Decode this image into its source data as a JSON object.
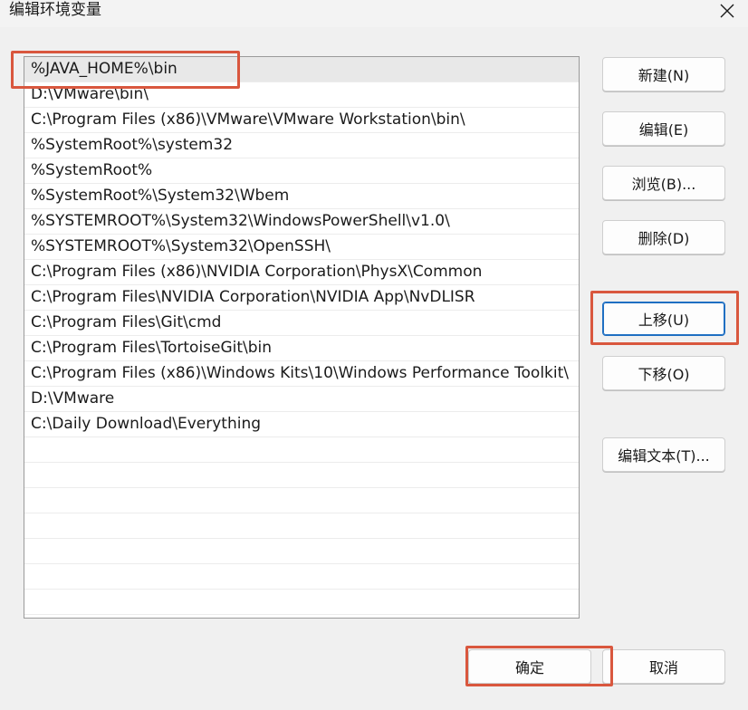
{
  "dialog": {
    "title": "编辑环境变量"
  },
  "paths": [
    "%JAVA_HOME%\\bin",
    "D:\\VMware\\bin\\",
    "C:\\Program Files (x86)\\VMware\\VMware Workstation\\bin\\",
    "%SystemRoot%\\system32",
    "%SystemRoot%",
    "%SystemRoot%\\System32\\Wbem",
    "%SYSTEMROOT%\\System32\\WindowsPowerShell\\v1.0\\",
    "%SYSTEMROOT%\\System32\\OpenSSH\\",
    "C:\\Program Files (x86)\\NVIDIA Corporation\\PhysX\\Common",
    "C:\\Program Files\\NVIDIA Corporation\\NVIDIA App\\NvDLISR",
    "C:\\Program Files\\Git\\cmd",
    "C:\\Program Files\\TortoiseGit\\bin",
    "C:\\Program Files (x86)\\Windows Kits\\10\\Windows Performance Toolkit\\",
    "D:\\VMware",
    "C:\\Daily Download\\Everything"
  ],
  "selected_index": 0,
  "buttons": {
    "new": "新建(N)",
    "edit": "编辑(E)",
    "browse": "浏览(B)...",
    "delete": "删除(D)",
    "move_up": "上移(U)",
    "move_down": "下移(O)",
    "edit_text": "编辑文本(T)...",
    "ok": "确定",
    "cancel": "取消"
  },
  "colors": {
    "highlight": "#d9573e",
    "focus": "#1f6fc2",
    "selected_row": "#e8e8e8"
  }
}
